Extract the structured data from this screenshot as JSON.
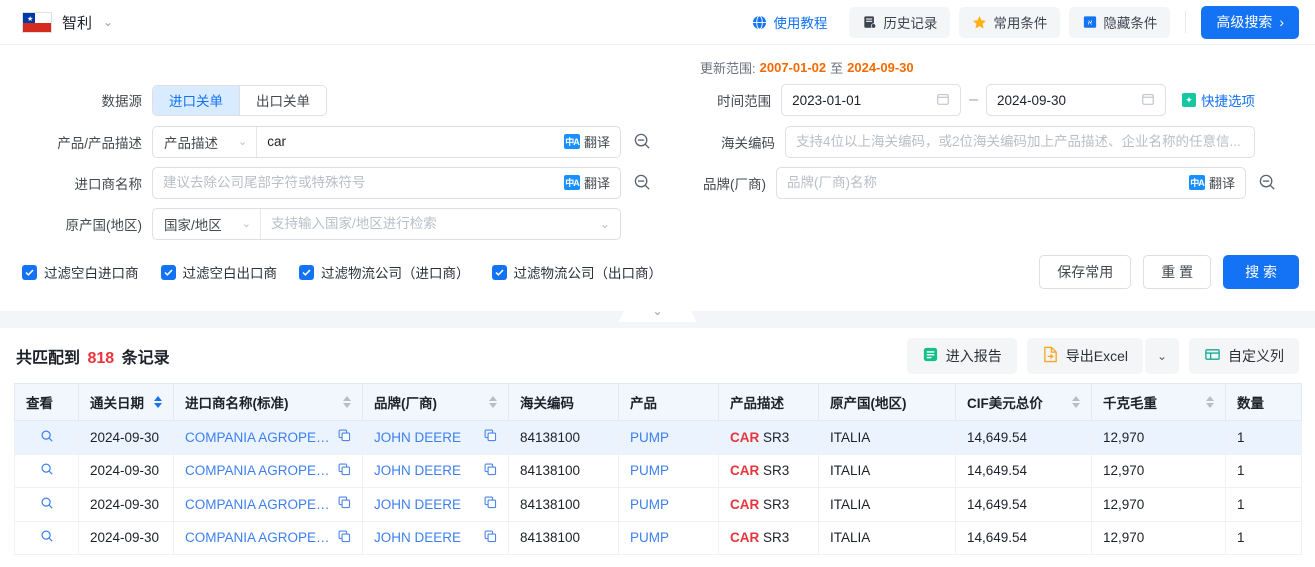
{
  "topbar": {
    "country_label": "智利",
    "country_caret": "chevron-down-icon",
    "nav": [
      {
        "label": "使用教程",
        "icon": "globe-icon",
        "style": "plain"
      },
      {
        "label": "历史记录",
        "icon": "history-icon",
        "style": "chip"
      },
      {
        "label": "常用条件",
        "icon": "star-icon",
        "style": "chip"
      },
      {
        "label": "隐藏条件",
        "icon": "hide-icon",
        "style": "chip"
      }
    ],
    "advanced_label": "高级搜索",
    "advanced_arrow": "›"
  },
  "search": {
    "datasource_label": "数据源",
    "datasource_tabs": [
      {
        "label": "进口关单",
        "active": true
      },
      {
        "label": "出口关单",
        "active": false
      }
    ],
    "product_label": "产品/产品描述",
    "product_select": "产品描述",
    "product_value": "car",
    "importer_label": "进口商名称",
    "importer_placeholder": "建议去除公司尾部字符或特殊符号",
    "origin_label": "原产国(地区)",
    "origin_select": "国家/地区",
    "origin_placeholder": "支持输入国家/地区进行检索",
    "translate_label": "翻译",
    "update_range_prefix": "更新范围:",
    "update_range_start": "2007-01-02",
    "update_range_sep": "至",
    "update_range_end": "2024-09-30",
    "time_label": "时间范围",
    "date_start": "2023-01-01",
    "date_end": "2024-09-30",
    "quick_label": "快捷选项",
    "hs_label": "海关编码",
    "hs_placeholder": "支持4位以上海关编码，或2位海关编码加上产品描述、企业名称的任意信...",
    "brand_label": "品牌(厂商)",
    "brand_placeholder": "品牌(厂商)名称",
    "checkboxes": [
      {
        "label": "过滤空白进口商",
        "checked": true
      },
      {
        "label": "过滤空白出口商",
        "checked": true
      },
      {
        "label": "过滤物流公司（进口商）",
        "checked": true
      },
      {
        "label": "过滤物流公司（出口商）",
        "checked": true
      }
    ],
    "save_label": "保存常用",
    "reset_label": "重 置",
    "search_label": "搜 索"
  },
  "results": {
    "count_prefix": "共匹配到",
    "count": "818",
    "count_suffix": "条记录",
    "report_label": "进入报告",
    "export_label": "导出Excel",
    "custom_cols_label": "自定义列",
    "columns": [
      {
        "label": "查看",
        "sortable": false
      },
      {
        "label": "通关日期",
        "sortable": true,
        "active": true
      },
      {
        "label": "进口商名称(标准)",
        "sortable": true
      },
      {
        "label": "品牌(厂商)",
        "sortable": true
      },
      {
        "label": "海关编码",
        "sortable": false
      },
      {
        "label": "产品",
        "sortable": false
      },
      {
        "label": "产品描述",
        "sortable": false
      },
      {
        "label": "原产国(地区)",
        "sortable": false
      },
      {
        "label": "CIF美元总价",
        "sortable": true
      },
      {
        "label": "千克毛重",
        "sortable": true
      },
      {
        "label": "数量",
        "sortable": false
      }
    ],
    "rows": [
      {
        "date": "2024-09-30",
        "importer": "COMPANIA AGROPEC...",
        "brand": "JOHN DEERE",
        "hs": "84138100",
        "product": "PUMP",
        "desc_hit": "CAR",
        "desc_rest": " SR3",
        "origin": "ITALIA",
        "cif": "14,649.54",
        "weight": "12,970",
        "qty": "1"
      },
      {
        "date": "2024-09-30",
        "importer": "COMPANIA AGROPEC...",
        "brand": "JOHN DEERE",
        "hs": "84138100",
        "product": "PUMP",
        "desc_hit": "CAR",
        "desc_rest": " SR3",
        "origin": "ITALIA",
        "cif": "14,649.54",
        "weight": "12,970",
        "qty": "1"
      },
      {
        "date": "2024-09-30",
        "importer": "COMPANIA AGROPEC...",
        "brand": "JOHN DEERE",
        "hs": "84138100",
        "product": "PUMP",
        "desc_hit": "CAR",
        "desc_rest": " SR3",
        "origin": "ITALIA",
        "cif": "14,649.54",
        "weight": "12,970",
        "qty": "1"
      },
      {
        "date": "2024-09-30",
        "importer": "COMPANIA AGROPEC...",
        "brand": "JOHN DEERE",
        "hs": "84138100",
        "product": "PUMP",
        "desc_hit": "CAR",
        "desc_rest": " SR3",
        "origin": "ITALIA",
        "cif": "14,649.54",
        "weight": "12,970",
        "qty": "1"
      }
    ]
  },
  "colors": {
    "accent": "#1472f5",
    "link": "#3d7ff0",
    "danger": "#e8353c",
    "orange": "#f56a00",
    "header_bg": "#f2f6fd",
    "row_hl": "#eaf3fe"
  }
}
